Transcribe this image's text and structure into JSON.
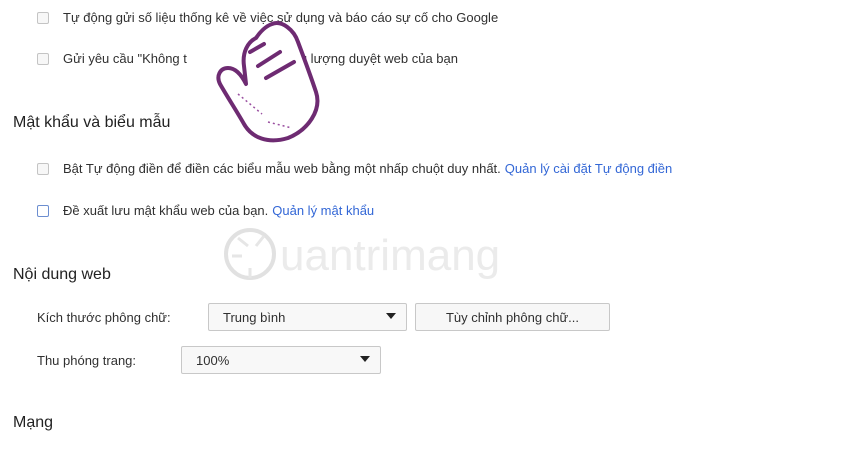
{
  "privacy": {
    "items": [
      {
        "label": "Tự động gửi số liệu thống kê về việc sử dụng và báo cáo sự cố cho Google"
      },
      {
        "label": "Gửi yêu cầu \"Không t",
        "label_tail": "m theo lưu lượng duyệt web của bạn"
      }
    ]
  },
  "passwords": {
    "title": "Mật khẩu và biểu mẫu",
    "autofill_label": "Bật Tự động điền để điền các biểu mẫu web bằng một nhấp chuột duy nhất.",
    "autofill_link": "Quản lý cài đặt Tự động điền",
    "save_label": "Đề xuất lưu mật khẩu web của bạn.",
    "save_link": "Quản lý mật khẩu"
  },
  "web_content": {
    "title": "Nội dung web",
    "font_size_label": "Kích thước phông chữ:",
    "font_size_value": "Trung bình",
    "customize_fonts_button": "Tùy chỉnh phông chữ...",
    "zoom_label": "Thu phóng trang:",
    "zoom_value": "100%"
  },
  "network": {
    "title": "Mạng"
  },
  "watermark": {
    "text": "uantrimang"
  },
  "icons": [
    "checkbox",
    "dropdown-arrow-icon",
    "pointing-hand-icon",
    "lightbulb-icon"
  ]
}
